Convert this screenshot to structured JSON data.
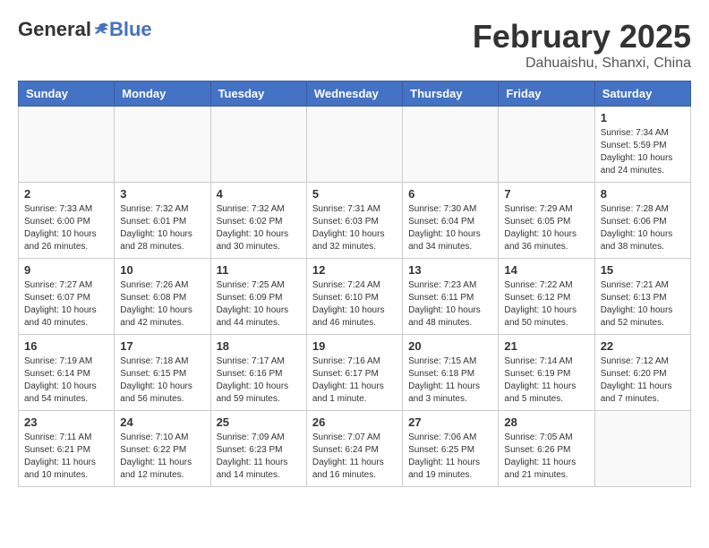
{
  "header": {
    "logo_general": "General",
    "logo_blue": "Blue",
    "month_title": "February 2025",
    "location": "Dahuaishu, Shanxi, China"
  },
  "days_of_week": [
    "Sunday",
    "Monday",
    "Tuesday",
    "Wednesday",
    "Thursday",
    "Friday",
    "Saturday"
  ],
  "weeks": [
    [
      {
        "day": "",
        "info": ""
      },
      {
        "day": "",
        "info": ""
      },
      {
        "day": "",
        "info": ""
      },
      {
        "day": "",
        "info": ""
      },
      {
        "day": "",
        "info": ""
      },
      {
        "day": "",
        "info": ""
      },
      {
        "day": "1",
        "info": "Sunrise: 7:34 AM\nSunset: 5:59 PM\nDaylight: 10 hours and 24 minutes."
      }
    ],
    [
      {
        "day": "2",
        "info": "Sunrise: 7:33 AM\nSunset: 6:00 PM\nDaylight: 10 hours and 26 minutes."
      },
      {
        "day": "3",
        "info": "Sunrise: 7:32 AM\nSunset: 6:01 PM\nDaylight: 10 hours and 28 minutes."
      },
      {
        "day": "4",
        "info": "Sunrise: 7:32 AM\nSunset: 6:02 PM\nDaylight: 10 hours and 30 minutes."
      },
      {
        "day": "5",
        "info": "Sunrise: 7:31 AM\nSunset: 6:03 PM\nDaylight: 10 hours and 32 minutes."
      },
      {
        "day": "6",
        "info": "Sunrise: 7:30 AM\nSunset: 6:04 PM\nDaylight: 10 hours and 34 minutes."
      },
      {
        "day": "7",
        "info": "Sunrise: 7:29 AM\nSunset: 6:05 PM\nDaylight: 10 hours and 36 minutes."
      },
      {
        "day": "8",
        "info": "Sunrise: 7:28 AM\nSunset: 6:06 PM\nDaylight: 10 hours and 38 minutes."
      }
    ],
    [
      {
        "day": "9",
        "info": "Sunrise: 7:27 AM\nSunset: 6:07 PM\nDaylight: 10 hours and 40 minutes."
      },
      {
        "day": "10",
        "info": "Sunrise: 7:26 AM\nSunset: 6:08 PM\nDaylight: 10 hours and 42 minutes."
      },
      {
        "day": "11",
        "info": "Sunrise: 7:25 AM\nSunset: 6:09 PM\nDaylight: 10 hours and 44 minutes."
      },
      {
        "day": "12",
        "info": "Sunrise: 7:24 AM\nSunset: 6:10 PM\nDaylight: 10 hours and 46 minutes."
      },
      {
        "day": "13",
        "info": "Sunrise: 7:23 AM\nSunset: 6:11 PM\nDaylight: 10 hours and 48 minutes."
      },
      {
        "day": "14",
        "info": "Sunrise: 7:22 AM\nSunset: 6:12 PM\nDaylight: 10 hours and 50 minutes."
      },
      {
        "day": "15",
        "info": "Sunrise: 7:21 AM\nSunset: 6:13 PM\nDaylight: 10 hours and 52 minutes."
      }
    ],
    [
      {
        "day": "16",
        "info": "Sunrise: 7:19 AM\nSunset: 6:14 PM\nDaylight: 10 hours and 54 minutes."
      },
      {
        "day": "17",
        "info": "Sunrise: 7:18 AM\nSunset: 6:15 PM\nDaylight: 10 hours and 56 minutes."
      },
      {
        "day": "18",
        "info": "Sunrise: 7:17 AM\nSunset: 6:16 PM\nDaylight: 10 hours and 59 minutes."
      },
      {
        "day": "19",
        "info": "Sunrise: 7:16 AM\nSunset: 6:17 PM\nDaylight: 11 hours and 1 minute."
      },
      {
        "day": "20",
        "info": "Sunrise: 7:15 AM\nSunset: 6:18 PM\nDaylight: 11 hours and 3 minutes."
      },
      {
        "day": "21",
        "info": "Sunrise: 7:14 AM\nSunset: 6:19 PM\nDaylight: 11 hours and 5 minutes."
      },
      {
        "day": "22",
        "info": "Sunrise: 7:12 AM\nSunset: 6:20 PM\nDaylight: 11 hours and 7 minutes."
      }
    ],
    [
      {
        "day": "23",
        "info": "Sunrise: 7:11 AM\nSunset: 6:21 PM\nDaylight: 11 hours and 10 minutes."
      },
      {
        "day": "24",
        "info": "Sunrise: 7:10 AM\nSunset: 6:22 PM\nDaylight: 11 hours and 12 minutes."
      },
      {
        "day": "25",
        "info": "Sunrise: 7:09 AM\nSunset: 6:23 PM\nDaylight: 11 hours and 14 minutes."
      },
      {
        "day": "26",
        "info": "Sunrise: 7:07 AM\nSunset: 6:24 PM\nDaylight: 11 hours and 16 minutes."
      },
      {
        "day": "27",
        "info": "Sunrise: 7:06 AM\nSunset: 6:25 PM\nDaylight: 11 hours and 19 minutes."
      },
      {
        "day": "28",
        "info": "Sunrise: 7:05 AM\nSunset: 6:26 PM\nDaylight: 11 hours and 21 minutes."
      },
      {
        "day": "",
        "info": ""
      }
    ]
  ]
}
